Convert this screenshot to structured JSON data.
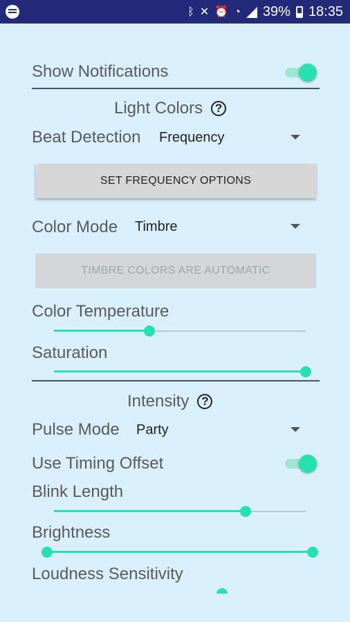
{
  "status_bar": {
    "battery": "39%",
    "time": "18:35"
  },
  "settings": {
    "show_notifications_label": "Show Notifications",
    "show_notifications_on": true,
    "light_colors_title": "Light Colors",
    "beat_detection_label": "Beat Detection",
    "beat_detection_value": "Frequency",
    "set_frequency_button": "SET FREQUENCY OPTIONS",
    "color_mode_label": "Color Mode",
    "color_mode_value": "Timbre",
    "timbre_button": "TIMBRE COLORS ARE AUTOMATIC",
    "color_temperature_label": "Color Temperature",
    "color_temperature_level": 0.38,
    "saturation_label": "Saturation",
    "saturation_level": 1.0,
    "intensity_title": "Intensity",
    "pulse_mode_label": "Pulse Mode",
    "pulse_mode_value": "Party",
    "use_timing_offset_label": "Use Timing Offset",
    "use_timing_offset_on": true,
    "blink_length_label": "Blink Length",
    "blink_length_level": 0.76,
    "brightness_label": "Brightness",
    "brightness_min_level": 0.0,
    "brightness_max_level": 1.0,
    "loudness_sensitivity_label": "Loudness Sensitivity",
    "help_symbol": "?"
  },
  "colors": {
    "accent": "#27e0b0",
    "status_bar": "#232a7a",
    "background": "#d9effb",
    "divider": "#3f4e8e"
  }
}
